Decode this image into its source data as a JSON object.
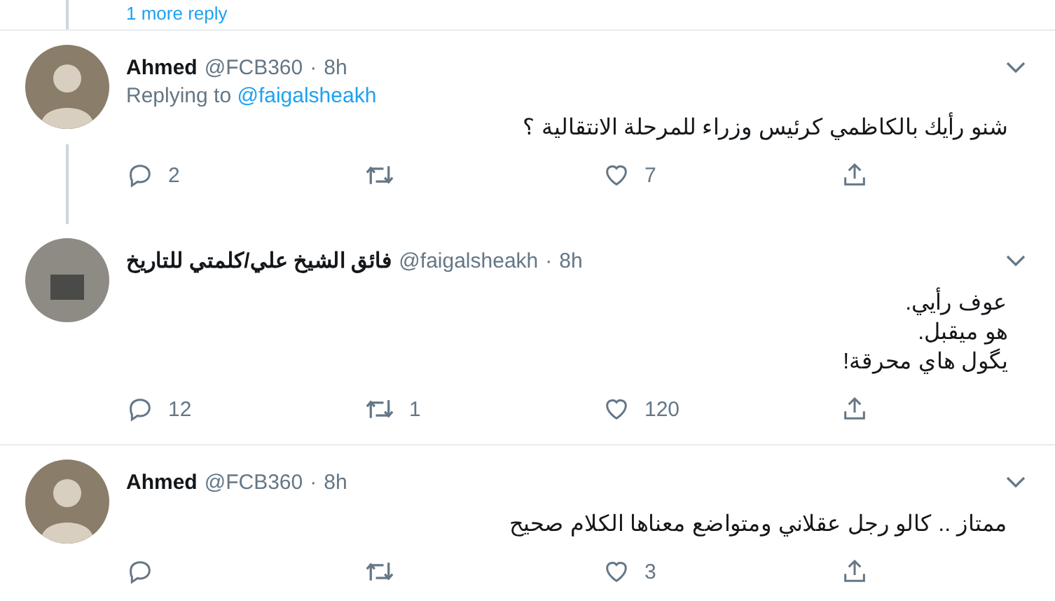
{
  "more_replies": {
    "label": "1 more reply"
  },
  "tweets": [
    {
      "name": "Ahmed",
      "handle": "@FCB360",
      "separator": "·",
      "time": "8h",
      "avatar": {
        "kind": "person"
      },
      "replying_prefix": "Replying to",
      "replying_to": "@faigalsheakh",
      "lines": [
        "شنو رأيك بالكاظمي كرئيس وزراء للمرحلة الانتقالية ؟"
      ],
      "replies": "2",
      "likes": "7",
      "thread_below": true
    },
    {
      "name": "فائق الشيخ علي/كلمتي للتاريخ",
      "handle": "@faigalsheakh",
      "separator": "·",
      "time": "8h",
      "avatar": {
        "kind": "scene"
      },
      "lines": [
        "عوف رأيي.",
        "هو ميقبل.",
        "يگول هاي محرقة!"
      ],
      "replies": "12",
      "retweets": "1",
      "likes": "120",
      "thread_below": false
    },
    {
      "name": "Ahmed",
      "handle": "@FCB360",
      "separator": "·",
      "time": "8h",
      "avatar": {
        "kind": "person"
      },
      "lines": [
        "ممتاز .. كالو رجل عقلاني ومتواضع معناها الكلام صحيح"
      ],
      "likes": "3",
      "thread_below": false
    }
  ]
}
